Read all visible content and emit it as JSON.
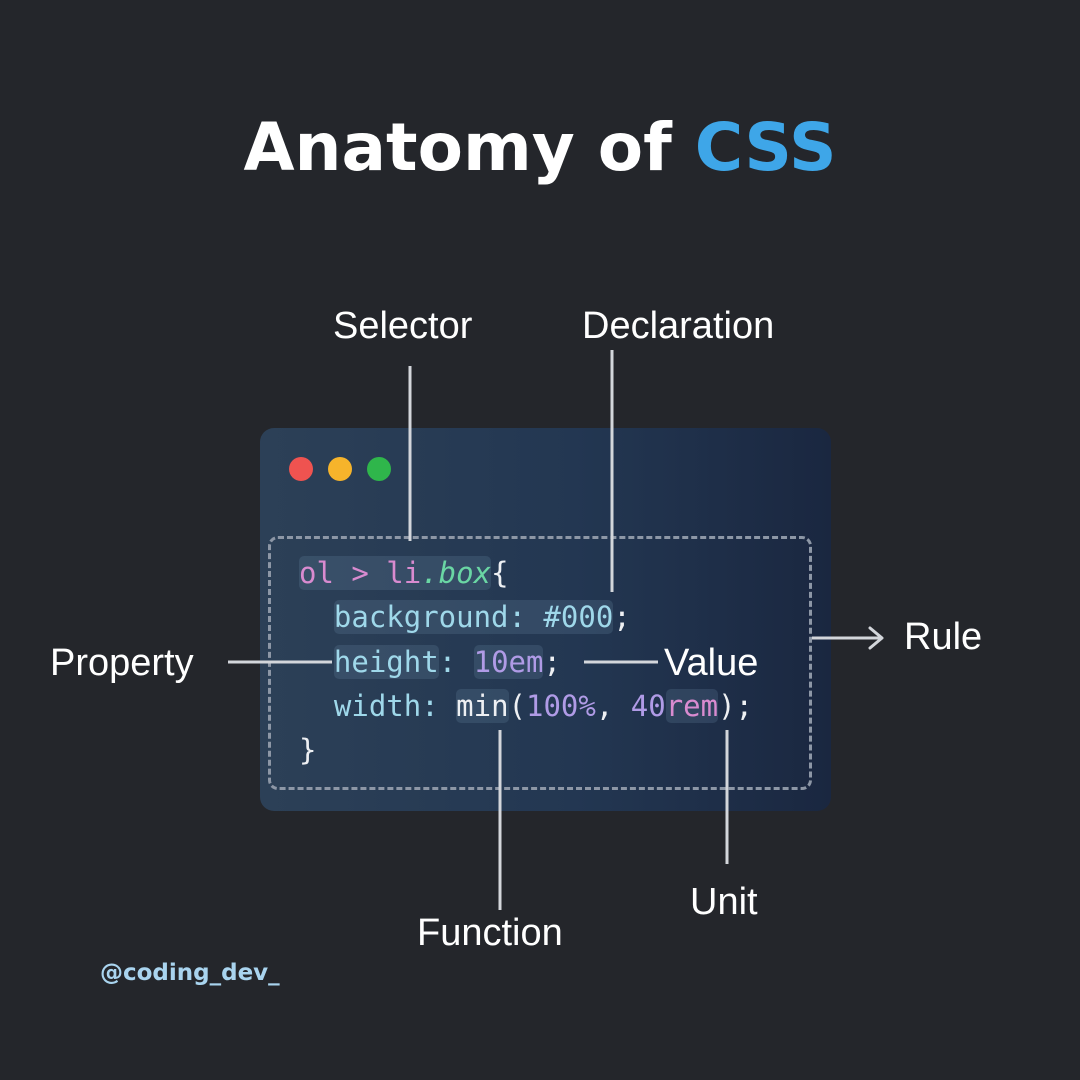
{
  "title": {
    "prefix": "Anatomy of ",
    "accent": "CSS"
  },
  "labels": {
    "selector": "Selector",
    "declaration": "Declaration",
    "property": "Property",
    "value": "Value",
    "rule": "Rule",
    "function": "Function",
    "unit": "Unit"
  },
  "code": {
    "line1": {
      "sel_a": "ol > li",
      "sel_b": ".box",
      "brace": "{"
    },
    "line2": {
      "decl": "background: #000",
      "semi": ";"
    },
    "line3": {
      "prop": "height",
      "colon": ": ",
      "value": "10em",
      "semi": ";"
    },
    "line4": {
      "prop": "width:",
      "space": " ",
      "func": "min",
      "paren_open": "(",
      "arg1": "100%",
      "comma": ", ",
      "num": "40",
      "unit": "rem",
      "paren_close": ");"
    },
    "line5": {
      "brace": "}"
    }
  },
  "handle": "@coding_dev_",
  "colors": {
    "background": "#24262b",
    "accent": "#3ea6e8",
    "dot_red": "#ef5350",
    "dot_yellow": "#f6b42b",
    "dot_green": "#2fb64b",
    "connector": "#d3d6db"
  },
  "icons": [
    "window-close-dot",
    "window-minimize-dot",
    "window-maximize-dot",
    "arrow-right-icon"
  ]
}
